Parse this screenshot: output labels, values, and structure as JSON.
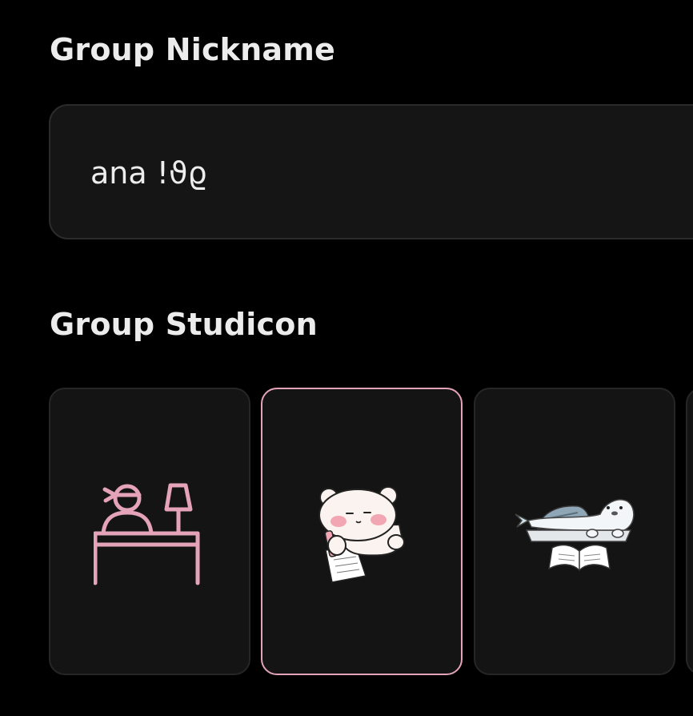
{
  "nickname": {
    "label": "Group Nickname",
    "value": "ana !ϑϱ"
  },
  "studicon": {
    "label": "Group Studicon",
    "options": [
      {
        "icon": "student-at-desk-icon",
        "selected": false
      },
      {
        "icon": "bear-writing-icon",
        "selected": true
      },
      {
        "icon": "seal-reading-book-icon",
        "selected": false
      },
      {
        "icon": "partial-studicon-card",
        "selected": false
      }
    ]
  },
  "colors": {
    "background": "#000000",
    "field_background": "#151515",
    "accent_pink": "#e4a3b9",
    "text": "#ececec"
  }
}
